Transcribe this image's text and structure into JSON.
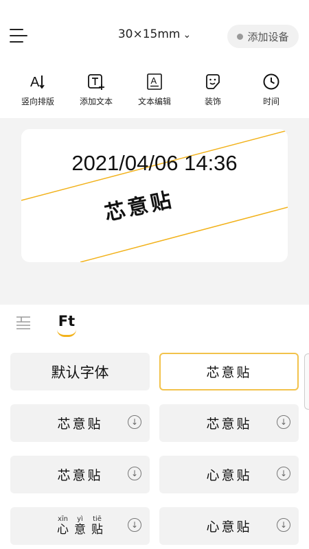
{
  "header": {
    "size_label": "30×15mm",
    "size_chevron": "⌄",
    "add_device_label": "添加设备"
  },
  "toolbar": {
    "items": [
      {
        "label": "竖向排版",
        "icon": "vertical-layout-icon"
      },
      {
        "label": "添加文本",
        "icon": "add-text-icon"
      },
      {
        "label": "文本编辑",
        "icon": "text-edit-icon"
      },
      {
        "label": "装饰",
        "icon": "sticker-icon"
      },
      {
        "label": "时间",
        "icon": "clock-icon"
      }
    ]
  },
  "preview": {
    "date_text": "2021/04/06 14:36",
    "brand_text": "芯意贴",
    "guide_line_color": "#f2b21b"
  },
  "tabs": {
    "font_tab_label": "Ft",
    "accent_color": "#f2b21b"
  },
  "fonts": [
    {
      "label": "默认字体",
      "style": "name",
      "selected": false,
      "download": false
    },
    {
      "label": "芯意贴",
      "style": "sample",
      "selected": true,
      "download": false
    },
    {
      "label": "芯意贴",
      "style": "sample",
      "selected": false,
      "download": true
    },
    {
      "label": "芯意贴",
      "style": "sample",
      "selected": false,
      "download": true
    },
    {
      "label": "芯意贴",
      "style": "sample",
      "selected": false,
      "download": true
    },
    {
      "label": "心意贴",
      "style": "sample",
      "selected": false,
      "download": true
    },
    {
      "label": "pinyin",
      "style": "pinyin",
      "selected": false,
      "download": true,
      "chars": [
        {
          "pinyin": "xīn",
          "hanzi": "心"
        },
        {
          "pinyin": "yì",
          "hanzi": "意"
        },
        {
          "pinyin": "tiē",
          "hanzi": "贴"
        }
      ]
    },
    {
      "label": "心意贴",
      "style": "sample",
      "selected": false,
      "download": true
    }
  ]
}
